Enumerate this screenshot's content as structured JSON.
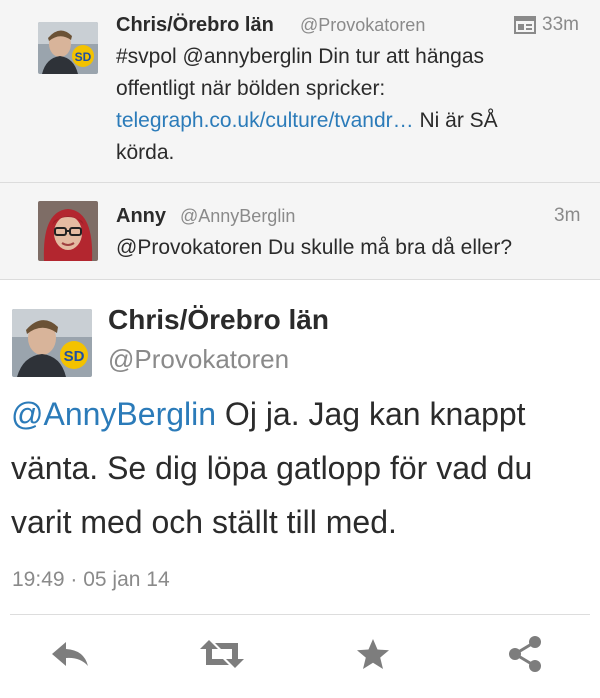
{
  "tweet1": {
    "name": "Chris/Örebro län",
    "handle": "@Provokatoren",
    "time": "33m",
    "line1": "#svpol @annyberglin Din tur att hängas",
    "line2": "offentligt när bölden spricker:",
    "link": "telegraph.co.uk/culture/tvandr…",
    "line3_rest": " Ni är SÅ",
    "line4": "körda.",
    "avatar_badge": "SD",
    "icons": {
      "media": "card-icon"
    }
  },
  "tweet2": {
    "name": "Anny",
    "handle": "@AnnyBerglin",
    "time": "3m",
    "text": "@Provokatoren Du skulle må bra då eller?"
  },
  "focused": {
    "name": "Chris/Örebro län",
    "handle": "@Provokatoren",
    "mention": "@AnnyBerglin",
    "line1_rest": " Oj ja. Jag kan knappt",
    "line2": "vänta. Se dig löpa gatlopp för vad du",
    "line3": "varit med och ställt till med.",
    "timestamp": "19:49 · 05 jan 14",
    "avatar_badge": "SD"
  },
  "actions": {
    "icons": [
      "reply-icon",
      "retweet-icon",
      "favorite-icon",
      "share-icon"
    ]
  },
  "colors": {
    "link": "#2b7bb9",
    "muted": "#8a8a8a",
    "icon": "#7d7d7d",
    "badge": "#f3c200"
  }
}
